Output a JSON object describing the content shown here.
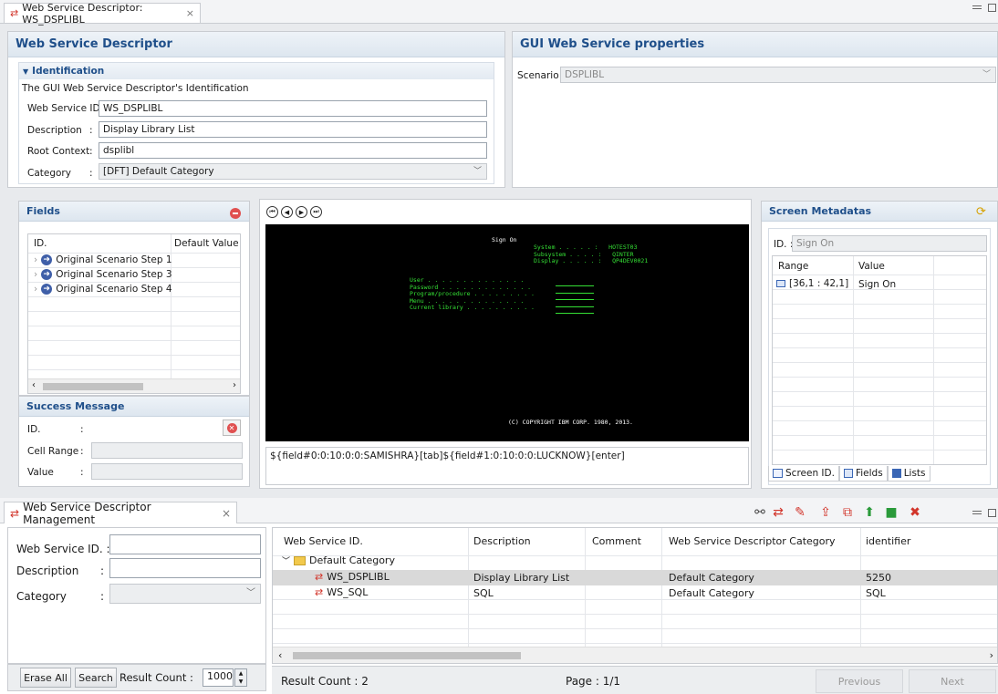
{
  "editor": {
    "tab_title": "Web Service Descriptor: WS_DSPLIBL",
    "close": "×"
  },
  "descriptor": {
    "title": "Web Service Descriptor",
    "ident_title": "Identification",
    "ident_desc": "The GUI Web Service Descriptor's Identification",
    "ws_id_label": "Web Service ID. :",
    "ws_id_value": "WS_DSPLIBL",
    "desc_label": "Description",
    "desc_value": "Display Library List",
    "root_label": "Root Context",
    "root_value": "dsplibl",
    "cat_label": "Category",
    "cat_value": "[DFT] Default Category",
    "colon": ":"
  },
  "gui": {
    "title": "GUI Web Service properties",
    "scenario_label": "Scenario :",
    "scenario_value": "DSPLIBL"
  },
  "fields": {
    "title": "Fields",
    "col_id": "ID.",
    "col_default": "Default Value",
    "items": [
      "Original Scenario Step 1",
      "Original Scenario Step 3",
      "Original Scenario Step 4"
    ]
  },
  "success": {
    "title": "Success Message",
    "id_label": "ID.",
    "cell_range_label": "Cell Range",
    "value_label": "Value",
    "colon": ":"
  },
  "terminal": {
    "header": "Sign On",
    "sysinfo": "System . . . . . :   HOTEST03\nSubsystem . . . . :   QINTER\nDisplay . . . . . :   QP4DEV0021",
    "fields": "User . . . . . . . . . . . . . .\nPassword . . . . . . . . . . . . .\nProgram/procedure . . . . . . . . .\nMenu . . . . . . . . . . . . . .\nCurrent library . . . . . . . . . .",
    "copyright": "(C) COPYRIGHT IBM CORP. 1980, 2013.",
    "script": "${field#0:0:10:0:0:SAMISHRA}[tab]${field#1:0:10:0:0:LUCKNOW}[enter]"
  },
  "metadata": {
    "title": "Screen Metadatas",
    "id_label": "ID. :",
    "id_value": "Sign On",
    "col_range": "Range",
    "col_value": "Value",
    "range": "[36,1 : 42,1]",
    "value": "Sign On",
    "tabs": [
      "Screen ID.",
      "Fields",
      "Lists"
    ]
  },
  "management": {
    "tab_title": "Web Service Descriptor Management",
    "ws_id_label": "Web Service ID. :",
    "desc_label": "Description",
    "cat_label": "Category",
    "colon": ":",
    "erase_all": "Erase All",
    "search": "Search",
    "result_count_label": "Result Count :",
    "result_count_value": "1000",
    "columns": [
      "Web Service ID.",
      "Description",
      "Comment",
      "Web Service Descriptor Category",
      "identifier"
    ],
    "group": "Default Category",
    "rows": [
      {
        "id": "WS_DSPLIBL",
        "desc": "Display Library List",
        "comment": "",
        "cat": "Default Category",
        "ident": "5250"
      },
      {
        "id": "WS_SQL",
        "desc": "SQL",
        "comment": "",
        "cat": "Default Category",
        "ident": "SQL"
      }
    ],
    "footer_count": "Result Count : 2",
    "page": "Page : 1/1",
    "previous": "Previous",
    "next": "Next"
  },
  "colors": {
    "accent": "#1f4f8a",
    "terminal_bg": "#000000",
    "terminal_fg": "#35e035"
  }
}
